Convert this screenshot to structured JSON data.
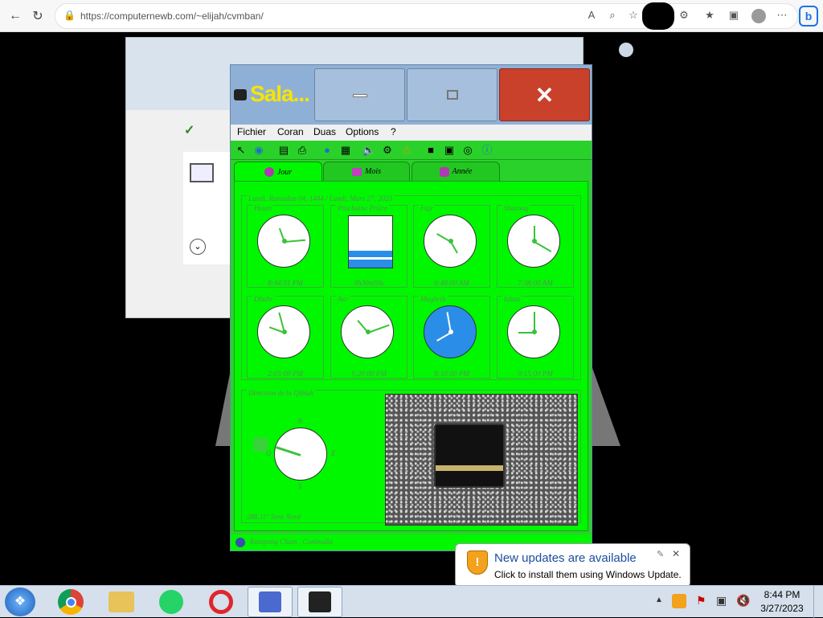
{
  "browser": {
    "url": "https://computernewb.com/~elijah/cvmban/"
  },
  "app": {
    "title": "Sala...",
    "menu": [
      "Fichier",
      "Coran",
      "Duas",
      "Options",
      "?"
    ],
    "tabs": [
      "Jour",
      "Mois",
      "Année"
    ],
    "date_line": "Lundi, Ramadan 04, 1444 / Lundi, Mars 27, 2023",
    "cells": [
      {
        "label": "Heure",
        "time": "8:44:01 PM"
      },
      {
        "label": "Prochaine Prière",
        "time": "0h30m59s"
      },
      {
        "label": "Fajr",
        "time": "6:48:00 AM"
      },
      {
        "label": "Shurooq",
        "time": "7:38:00 AM"
      },
      {
        "label": "Dhuhr",
        "time": "2:03:00 PM"
      },
      {
        "label": "Asr",
        "time": "5:20:00 PM"
      },
      {
        "label": "Maghrib",
        "time": "8:10:00 PM"
      },
      {
        "label": "Ishaa",
        "time": "9:15:00 PM"
      }
    ],
    "next_prayer_progress": 0.35,
    "qibla": {
      "label": "Direction de la Qiblah",
      "n": "N",
      "s": "S",
      "e": "E",
      "o": "O",
      "bearing": "288.11° Sens Nord"
    },
    "status": "Kampong Cham , Cambodia"
  },
  "notification": {
    "title": "New updates are available",
    "body": "Click to install them using Windows Update."
  },
  "taskbar": {
    "time": "8:44 PM",
    "date": "3/27/2023"
  },
  "colors": {
    "app_green": "#00f700",
    "title_yellow": "#f6e400",
    "close_red": "#c9402b"
  }
}
